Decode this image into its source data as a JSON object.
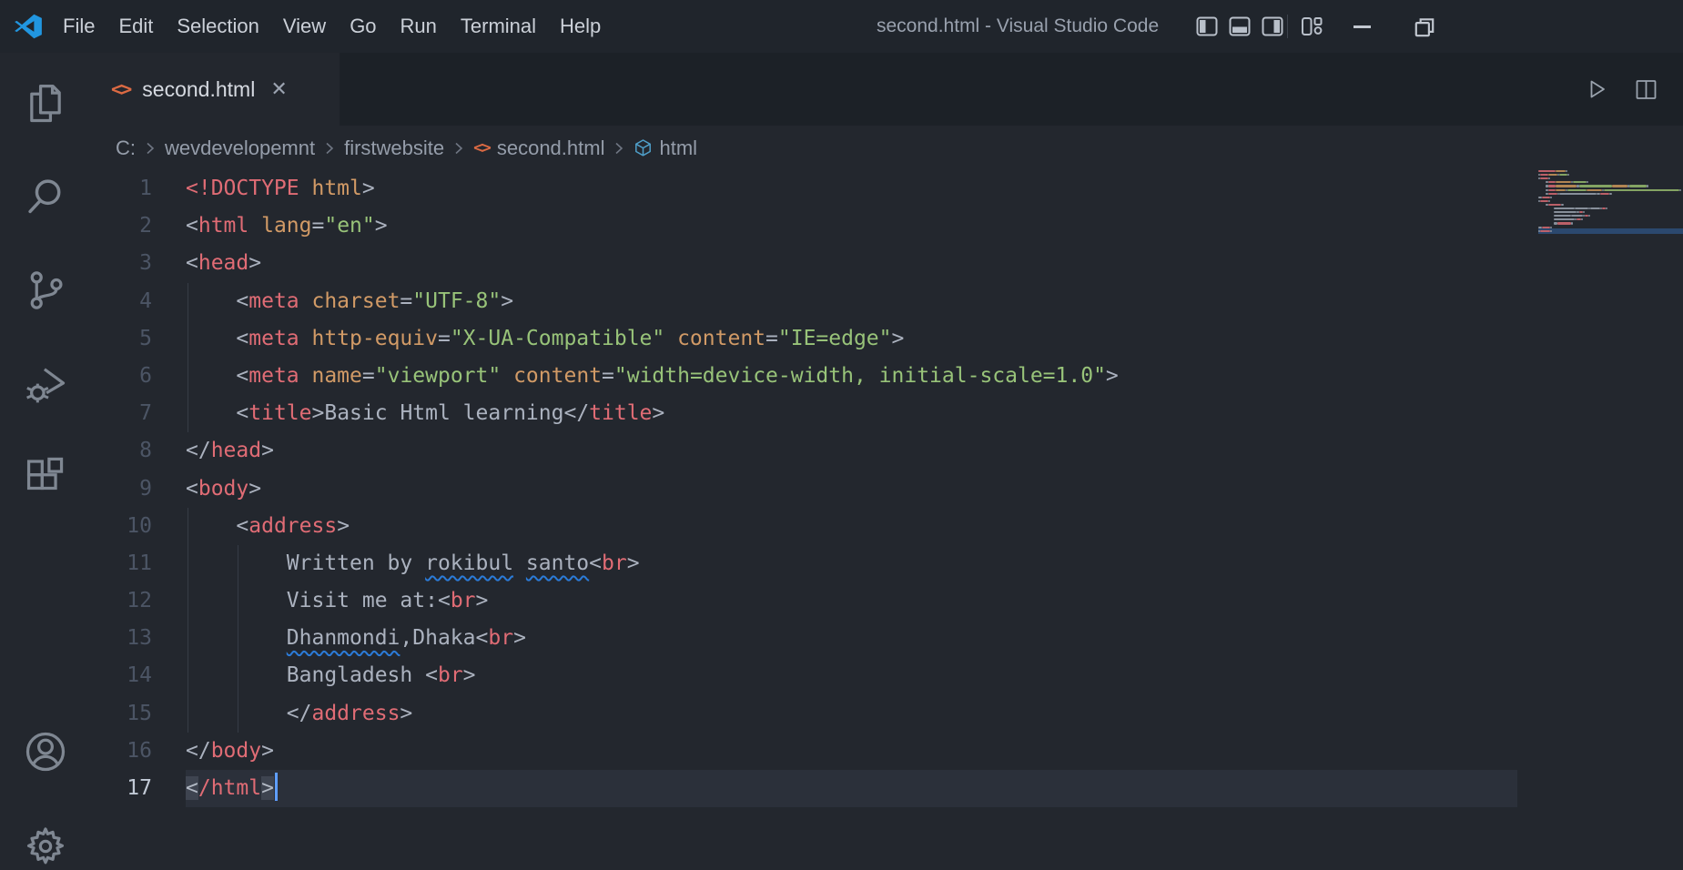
{
  "window": {
    "title": "second.html - Visual Studio Code"
  },
  "menu": {
    "items": [
      "File",
      "Edit",
      "Selection",
      "View",
      "Go",
      "Run",
      "Terminal",
      "Help"
    ]
  },
  "titlebar_controls": [
    "toggle-sidebar",
    "toggle-panel",
    "toggle-secondary-sidebar",
    "customize-layout",
    "minimize",
    "restore"
  ],
  "activity_bar": {
    "items": [
      "explorer",
      "search",
      "source-control",
      "run-and-debug",
      "extensions",
      "account",
      "settings"
    ]
  },
  "tabs": [
    {
      "label": "second.html",
      "icon": "html-file",
      "active": true
    }
  ],
  "editor_actions": [
    "run",
    "split-editor"
  ],
  "breadcrumb": {
    "items": [
      {
        "label": "C:"
      },
      {
        "label": "wevdevelopemnt"
      },
      {
        "label": "firstwebsite"
      },
      {
        "label": "second.html",
        "icon": "html-file"
      },
      {
        "label": "html",
        "icon": "symbol-cube"
      }
    ]
  },
  "editor": {
    "active_line": 17,
    "lines": [
      {
        "n": 1,
        "indent": 0,
        "guides": [],
        "tokens": [
          [
            "tag",
            "<!DOCTYPE"
          ],
          [
            "attr",
            " html"
          ],
          [
            "punct",
            ">"
          ]
        ]
      },
      {
        "n": 2,
        "indent": 0,
        "guides": [],
        "tokens": [
          [
            "punct",
            "<"
          ],
          [
            "tag",
            "html"
          ],
          [
            "attr",
            " lang"
          ],
          [
            "punct",
            "="
          ],
          [
            "str",
            "\"en\""
          ],
          [
            "punct",
            ">"
          ]
        ]
      },
      {
        "n": 3,
        "indent": 0,
        "guides": [],
        "tokens": [
          [
            "punct",
            "<"
          ],
          [
            "tag",
            "head"
          ],
          [
            "punct",
            ">"
          ]
        ]
      },
      {
        "n": 4,
        "indent": 4,
        "guides": [
          0
        ],
        "tokens": [
          [
            "punct",
            "<"
          ],
          [
            "tag",
            "meta"
          ],
          [
            "attr",
            " charset"
          ],
          [
            "punct",
            "="
          ],
          [
            "str",
            "\"UTF-8\""
          ],
          [
            "punct",
            ">"
          ]
        ]
      },
      {
        "n": 5,
        "indent": 4,
        "guides": [
          0
        ],
        "tokens": [
          [
            "punct",
            "<"
          ],
          [
            "tag",
            "meta"
          ],
          [
            "attr",
            " http-equiv"
          ],
          [
            "punct",
            "="
          ],
          [
            "str",
            "\"X-UA-Compatible\""
          ],
          [
            "attr",
            " content"
          ],
          [
            "punct",
            "="
          ],
          [
            "str",
            "\"IE=edge\""
          ],
          [
            "punct",
            ">"
          ]
        ]
      },
      {
        "n": 6,
        "indent": 4,
        "guides": [
          0
        ],
        "tokens": [
          [
            "punct",
            "<"
          ],
          [
            "tag",
            "meta"
          ],
          [
            "attr",
            " name"
          ],
          [
            "punct",
            "="
          ],
          [
            "str",
            "\"viewport\""
          ],
          [
            "attr",
            " content"
          ],
          [
            "punct",
            "="
          ],
          [
            "str",
            "\"width=device-width, initial-scale=1.0\""
          ],
          [
            "punct",
            ">"
          ]
        ]
      },
      {
        "n": 7,
        "indent": 4,
        "guides": [
          0
        ],
        "tokens": [
          [
            "punct",
            "<"
          ],
          [
            "tag",
            "title"
          ],
          [
            "punct",
            ">"
          ],
          [
            "text",
            "Basic Html learning"
          ],
          [
            "punct",
            "</"
          ],
          [
            "tag",
            "title"
          ],
          [
            "punct",
            ">"
          ]
        ]
      },
      {
        "n": 8,
        "indent": 0,
        "guides": [],
        "tokens": [
          [
            "punct",
            "</"
          ],
          [
            "tag",
            "head"
          ],
          [
            "punct",
            ">"
          ]
        ]
      },
      {
        "n": 9,
        "indent": 0,
        "guides": [],
        "tokens": [
          [
            "punct",
            "<"
          ],
          [
            "tag",
            "body"
          ],
          [
            "punct",
            ">"
          ]
        ]
      },
      {
        "n": 10,
        "indent": 4,
        "guides": [
          0
        ],
        "tokens": [
          [
            "punct",
            "<"
          ],
          [
            "tag",
            "address"
          ],
          [
            "punct",
            ">"
          ]
        ]
      },
      {
        "n": 11,
        "indent": 8,
        "guides": [
          0,
          4
        ],
        "tokens": [
          [
            "text",
            "Written by "
          ],
          [
            "sq",
            "rokibul"
          ],
          [
            "text",
            " "
          ],
          [
            "sq",
            "santo"
          ],
          [
            "punct",
            "<"
          ],
          [
            "tag",
            "br"
          ],
          [
            "punct",
            ">"
          ]
        ]
      },
      {
        "n": 12,
        "indent": 8,
        "guides": [
          0,
          4
        ],
        "tokens": [
          [
            "text",
            "Visit me at:"
          ],
          [
            "punct",
            "<"
          ],
          [
            "tag",
            "br"
          ],
          [
            "punct",
            ">"
          ]
        ]
      },
      {
        "n": 13,
        "indent": 8,
        "guides": [
          0,
          4
        ],
        "tokens": [
          [
            "sq",
            "Dhanmondi"
          ],
          [
            "text",
            ",Dhaka"
          ],
          [
            "punct",
            "<"
          ],
          [
            "tag",
            "br"
          ],
          [
            "punct",
            ">"
          ]
        ]
      },
      {
        "n": 14,
        "indent": 8,
        "guides": [
          0,
          4
        ],
        "tokens": [
          [
            "text",
            "Bangladesh "
          ],
          [
            "punct",
            "<"
          ],
          [
            "tag",
            "br"
          ],
          [
            "punct",
            ">"
          ]
        ]
      },
      {
        "n": 15,
        "indent": 8,
        "guides": [
          0,
          4
        ],
        "tokens": [
          [
            "punct",
            "</"
          ],
          [
            "tag",
            "address"
          ],
          [
            "punct",
            ">"
          ]
        ]
      },
      {
        "n": 16,
        "indent": 0,
        "guides": [],
        "tokens": [
          [
            "punct",
            "</"
          ],
          [
            "tag",
            "body"
          ],
          [
            "punct",
            ">"
          ]
        ]
      },
      {
        "n": 17,
        "indent": 0,
        "guides": [],
        "tokens": [
          [
            "bm",
            "<"
          ],
          [
            "tag",
            "/html"
          ],
          [
            "bm",
            ">"
          ],
          [
            "cursor",
            ""
          ]
        ]
      }
    ]
  },
  "colors": {
    "tag": "#e06c75",
    "attribute": "#d19a66",
    "string": "#98c379",
    "foreground": "#abb2bf",
    "squiggle": "#2b7bd8",
    "accent_html_icon": "#dc6a43",
    "cube_icon": "#4f9fc9",
    "cursor": "#5f9eff",
    "logo_blue": "#2196e0"
  }
}
